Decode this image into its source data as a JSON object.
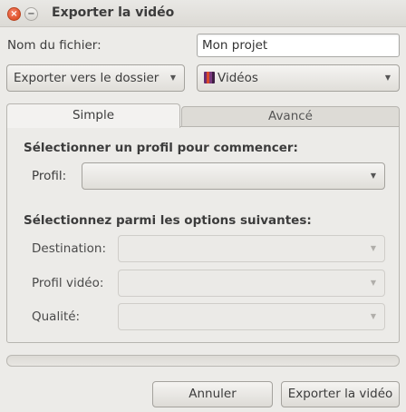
{
  "window": {
    "title": "Exporter la vidéo",
    "close_glyph": "×",
    "minimize_glyph": "−"
  },
  "filename": {
    "label": "Nom du fichier:",
    "value": "Mon projet"
  },
  "export_target": {
    "mode_value": "Exporter vers le dossier",
    "folder_value": "Vidéos",
    "folder_icon": "video-folder-icon"
  },
  "tabs": [
    {
      "label": "Simple",
      "active": true
    },
    {
      "label": "Avancé",
      "active": false
    }
  ],
  "simple": {
    "profile_section": "Sélectionner un profil pour commencer:",
    "profile_label": "Profil:",
    "profile_value": "",
    "options_section": "Sélectionnez parmi les options suivantes:",
    "destination_label": "Destination:",
    "destination_value": "",
    "video_profile_label": "Profil vidéo:",
    "video_profile_value": "",
    "quality_label": "Qualité:",
    "quality_value": ""
  },
  "progress": {
    "fraction": 0
  },
  "buttons": {
    "cancel": "Annuler",
    "export": "Exporter la vidéo"
  },
  "arrow_glyph": "▼",
  "colors": {
    "accent": "#e0522b",
    "window_bg": "#ecebe8"
  }
}
